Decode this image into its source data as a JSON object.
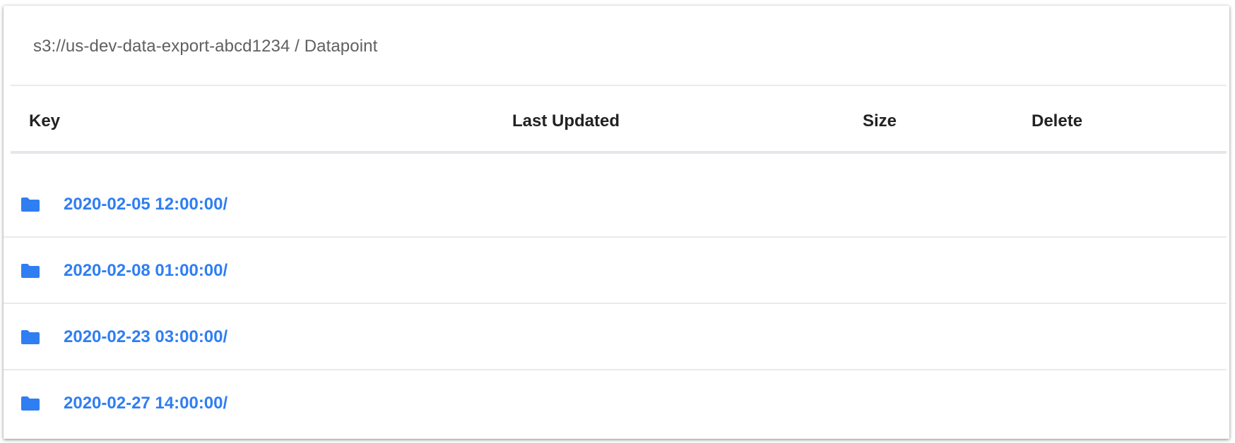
{
  "breadcrumb": {
    "path": "s3://us-dev-data-export-abcd1234 / Datapoint"
  },
  "table": {
    "columns": [
      "Key",
      "Last Updated",
      "Size",
      "Delete"
    ],
    "rows": [
      {
        "key": "2020-02-05 12:00:00/",
        "icon": "folder-icon"
      },
      {
        "key": "2020-02-08 01:00:00/",
        "icon": "folder-icon"
      },
      {
        "key": "2020-02-23 03:00:00/",
        "icon": "folder-icon"
      },
      {
        "key": "2020-02-27 14:00:00/",
        "icon": "folder-icon"
      }
    ]
  },
  "colors": {
    "link": "#2f7ef2",
    "header_text": "#222222",
    "path_text": "#606060"
  }
}
